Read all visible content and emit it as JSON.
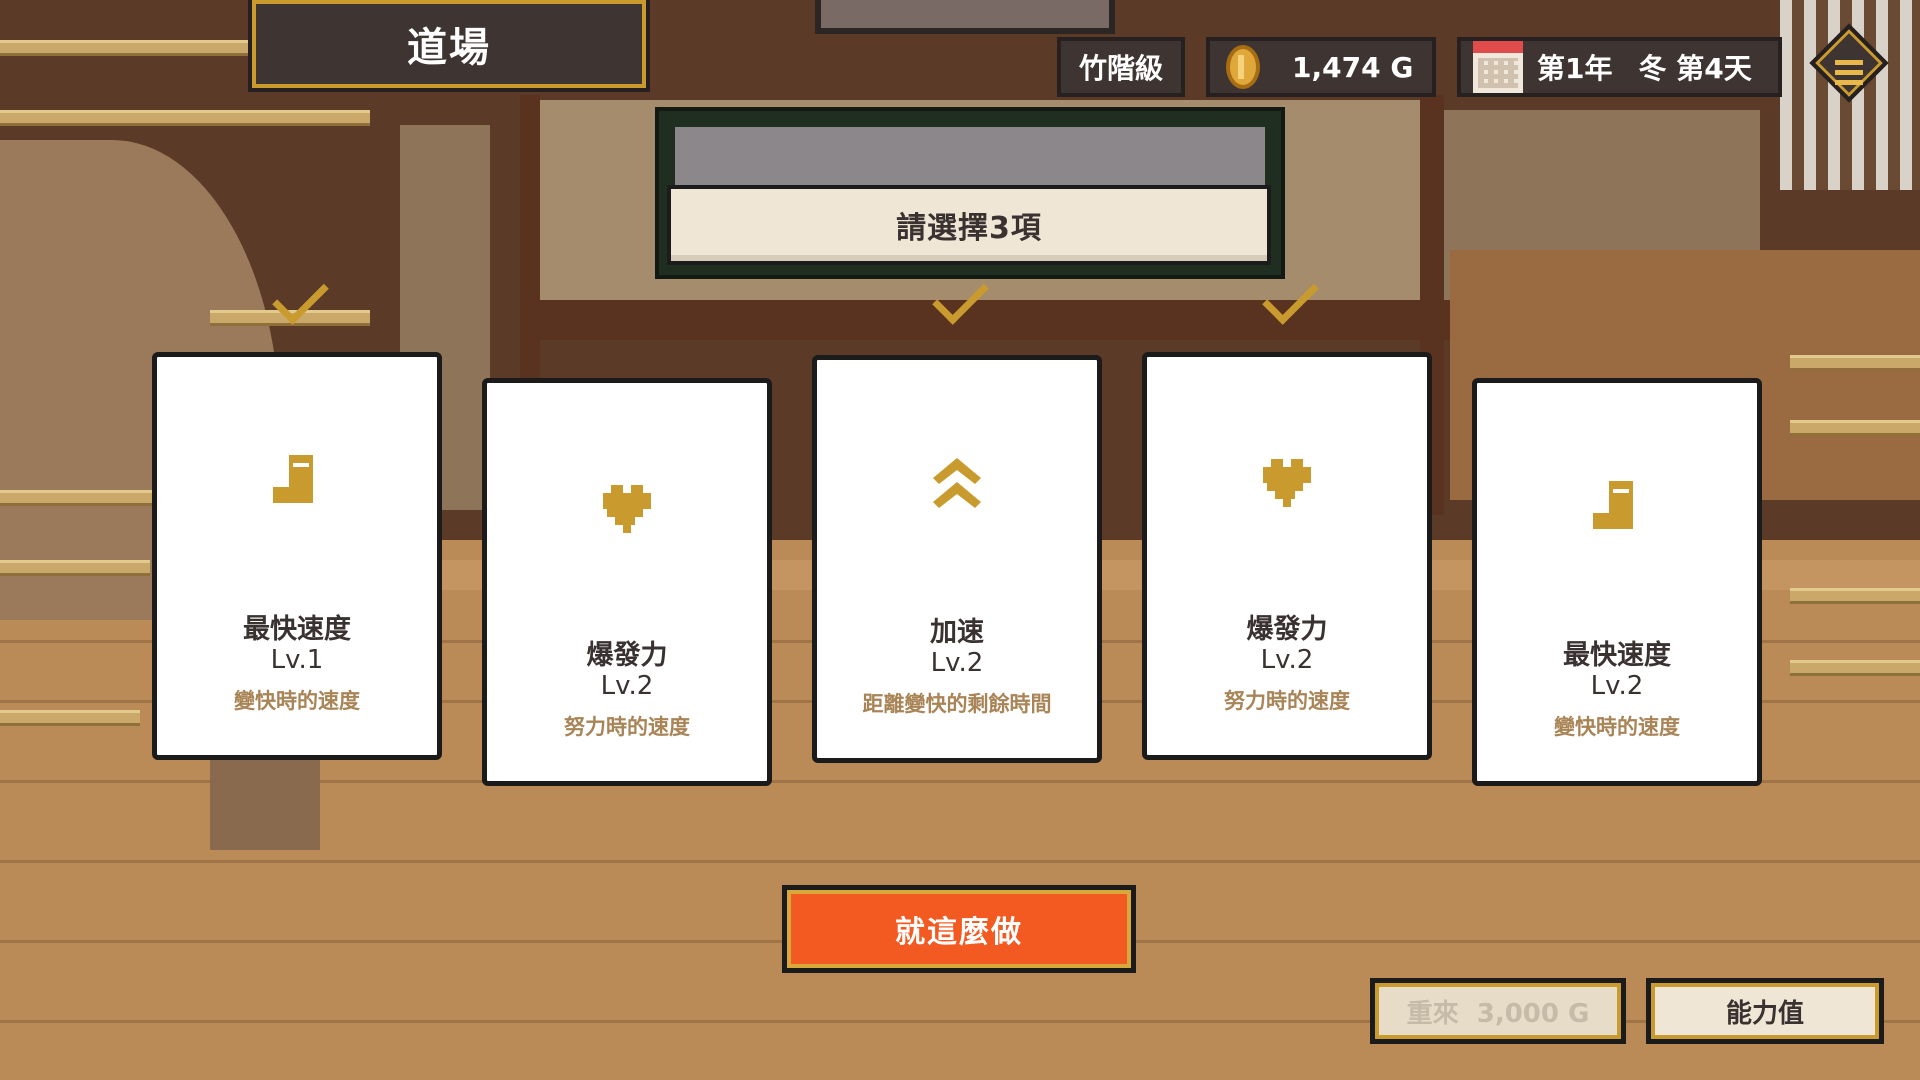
{
  "screen": {
    "title": "道場"
  },
  "status": {
    "rank": "竹階級",
    "gold": "1,474 G",
    "year": "第1年",
    "season_day": "冬 第4天"
  },
  "prompt": {
    "text": "請選擇3項",
    "required_selections": 3
  },
  "cards": [
    {
      "icon": "boot-icon",
      "name": "最快速度",
      "level": "Lv.1",
      "desc": "變快時的速度",
      "selected": true
    },
    {
      "icon": "heart-icon",
      "name": "爆發力",
      "level": "Lv.2",
      "desc": "努力時的速度",
      "selected": false
    },
    {
      "icon": "chevron-up-icon",
      "name": "加速",
      "level": "Lv.2",
      "desc": "距離變快的剩餘時間",
      "selected": true
    },
    {
      "icon": "heart-icon",
      "name": "爆發力",
      "level": "Lv.2",
      "desc": "努力時的速度",
      "selected": true
    },
    {
      "icon": "boot-icon",
      "name": "最快速度",
      "level": "Lv.2",
      "desc": "變快時的速度",
      "selected": false
    }
  ],
  "actions": {
    "confirm_label": "就這麼做",
    "redo_label": "重來  3,000 G",
    "stats_label": "能力值"
  },
  "colors": {
    "accent_gold": "#c99b2f",
    "confirm_orange": "#f25a22",
    "panel_dark": "#3e3431"
  }
}
